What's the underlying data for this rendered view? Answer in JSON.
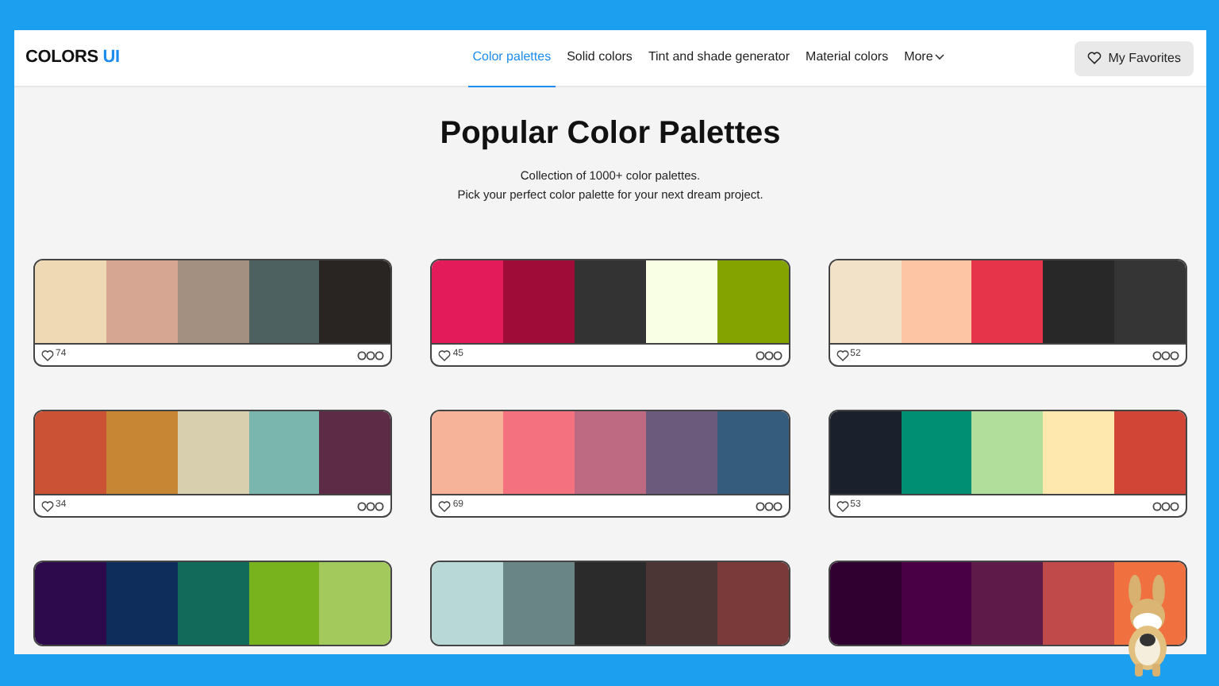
{
  "navbar": {
    "logo": {
      "text": "COLORS",
      "accent": "UI"
    },
    "links": [
      {
        "label": "Color palettes",
        "selected": true
      },
      {
        "label": "Solid colors",
        "selected": false
      },
      {
        "label": "Tint and shade generator",
        "selected": false
      },
      {
        "label": "Material colors",
        "selected": false
      },
      {
        "label": "More",
        "selected": false,
        "kind": "dropdown"
      }
    ],
    "favorites_button": "My Favorites"
  },
  "header": {
    "title": "Popular Color Palettes",
    "subtitle": [
      "Collection of 1000+ color palettes.",
      "Pick your perfect color palette for your next dream project."
    ]
  },
  "palettes": [
    {
      "swatches": [
        {
          "color": "#efd9b4"
        },
        {
          "color": "#d6a692"
        },
        {
          "color": "#a39081"
        },
        {
          "color": "#4d6160"
        },
        {
          "color": "#292522"
        }
      ],
      "likes": "74"
    },
    {
      "swatches": [
        {
          "color": "#e31b5a"
        },
        {
          "color": "#a00c38"
        },
        {
          "color": "#333333"
        },
        {
          "color": "#f9ffe5"
        },
        {
          "color": "#84a200"
        }
      ],
      "likes": "45"
    },
    {
      "swatches": [
        {
          "color": "#f2e2c7"
        },
        {
          "color": "#fec5a4"
        },
        {
          "color": "#e6344b"
        },
        {
          "color": "#282828"
        },
        {
          "color": "#353535"
        }
      ],
      "likes": "52"
    },
    {
      "swatches": [
        {
          "color": "#cb5234"
        },
        {
          "color": "#c78634"
        },
        {
          "color": "#d7cfae"
        },
        {
          "color": "#7ab5ae"
        },
        {
          "color": "#5d2b46"
        }
      ],
      "likes": "34"
    },
    {
      "swatches": [
        {
          "color": "#f6b39a"
        },
        {
          "color": "#f47280"
        },
        {
          "color": "#bf6a83"
        },
        {
          "color": "#6b5a7b"
        },
        {
          "color": "#355c7d"
        }
      ],
      "likes": "69"
    },
    {
      "swatches": [
        {
          "color": "#1b202d"
        },
        {
          "color": "#008f73"
        },
        {
          "color": "#b1de9a"
        },
        {
          "color": "#fee8ae"
        },
        {
          "color": "#d14537"
        }
      ],
      "likes": "53"
    },
    {
      "swatches": [
        {
          "color": "#2c0a4b"
        },
        {
          "color": "#0e2d5a"
        },
        {
          "color": "#126a5a"
        },
        {
          "color": "#78b31d"
        },
        {
          "color": "#a3c85c"
        }
      ]
    },
    {
      "swatches": [
        {
          "color": "#b8d8d8"
        },
        {
          "color": "#6a8585"
        },
        {
          "color": "#2b2b2b"
        },
        {
          "color": "#4b3535"
        },
        {
          "color": "#7a3a3a"
        }
      ]
    },
    {
      "swatches": [
        {
          "color": "#300030"
        },
        {
          "color": "#4a0045"
        },
        {
          "color": "#5e1a48"
        },
        {
          "color": "#c04a4a"
        },
        {
          "color": "#f07040"
        }
      ]
    }
  ]
}
